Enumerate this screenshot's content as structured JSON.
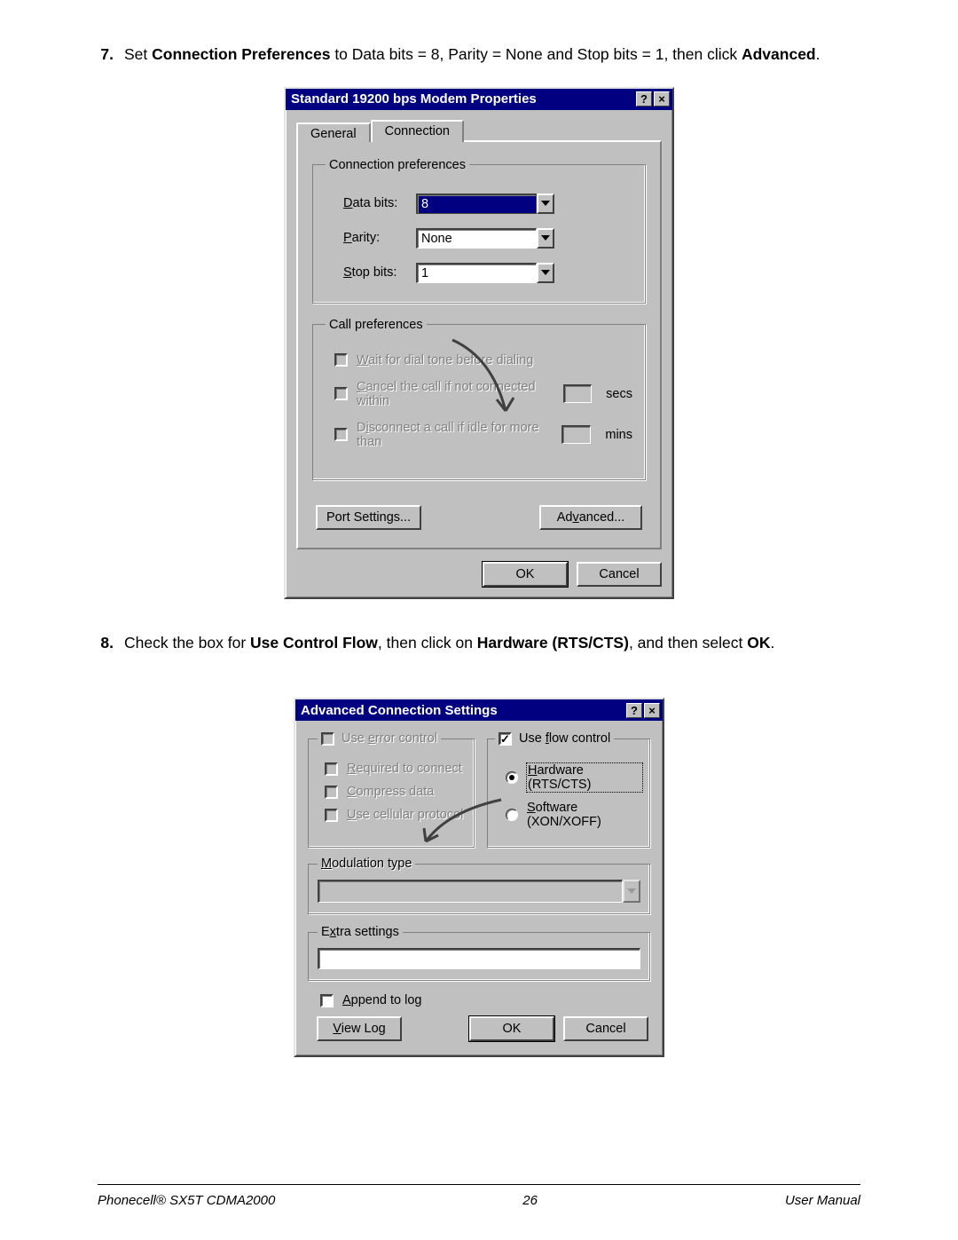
{
  "steps": {
    "s7": {
      "num": "7.",
      "html": "Set <b>Connection Preferences</b> to Data bits = 8, Parity = None and Stop bits = 1, then click <b>Advanced</b>."
    },
    "s8": {
      "num": "8.",
      "html": "Check the box for <b>Use Control Flow</b>, then click on <b>Hardware (RTS/CTS)</b>, and then select <b>OK</b>."
    }
  },
  "dialog1": {
    "title": "Standard 19200 bps Modem Properties",
    "tabs": {
      "general": "General",
      "connection": "Connection"
    },
    "group1_title": "Connection preferences",
    "data_bits_label": "Data bits:",
    "data_bits_value": "8",
    "parity_label": "Parity:",
    "parity_value": "None",
    "stop_bits_label": "Stop bits:",
    "stop_bits_value": "1",
    "group2_title": "Call preferences",
    "wait_label": "Wait for dial tone before dialing",
    "cancel_call_label": "Cancel the call if not connected within",
    "cancel_call_unit": "secs",
    "disconnect_label": "Disconnect a call if idle for more than",
    "disconnect_unit": "mins",
    "port_settings_btn": "Port Settings...",
    "advanced_btn": "Advanced...",
    "ok_btn": "OK",
    "cancel_btn": "Cancel"
  },
  "dialog2": {
    "title": "Advanced Connection Settings",
    "error_group": "Use error control",
    "required": "Required to connect",
    "compress": "Compress data",
    "cellular": "Use cellular protocol",
    "flow_group": "Use flow control",
    "hardware": "Hardware (RTS/CTS)",
    "software": "Software (XON/XOFF)",
    "modulation": "Modulation type",
    "extra": "Extra settings",
    "append": "Append to log",
    "view_log": "View Log",
    "ok_btn": "OK",
    "cancel_btn": "Cancel"
  },
  "footer": {
    "left": "Phonecell® SX5T CDMA2000",
    "center": "26",
    "right": "User Manual"
  }
}
